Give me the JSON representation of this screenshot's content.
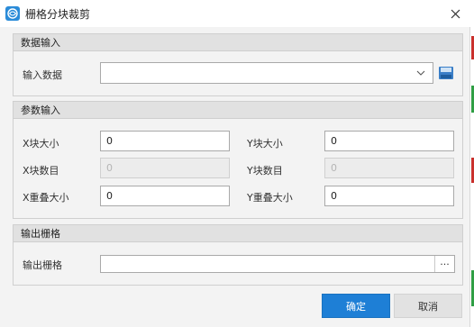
{
  "window": {
    "title": "栅格分块裁剪",
    "close_symbol": "✕"
  },
  "data_input": {
    "header": "数据输入",
    "input_label": "输入数据",
    "input_value": ""
  },
  "params": {
    "header": "参数输入",
    "x_block_size_label": "X块大小",
    "x_block_size_value": "0",
    "y_block_size_label": "Y块大小",
    "y_block_size_value": "0",
    "x_block_count_label": "X块数目",
    "x_block_count_value": "0",
    "y_block_count_label": "Y块数目",
    "y_block_count_value": "0",
    "x_overlap_label": "X重叠大小",
    "x_overlap_value": "0",
    "y_overlap_label": "Y重叠大小",
    "y_overlap_value": "0"
  },
  "output": {
    "header": "输出栅格",
    "output_label": "输出栅格",
    "output_value": "",
    "browse_label": "..."
  },
  "buttons": {
    "ok": "确定",
    "cancel": "取消"
  },
  "colors": {
    "primary": "#1e7fd6",
    "background": "#f3f3f3",
    "header": "#e1e1e1"
  }
}
